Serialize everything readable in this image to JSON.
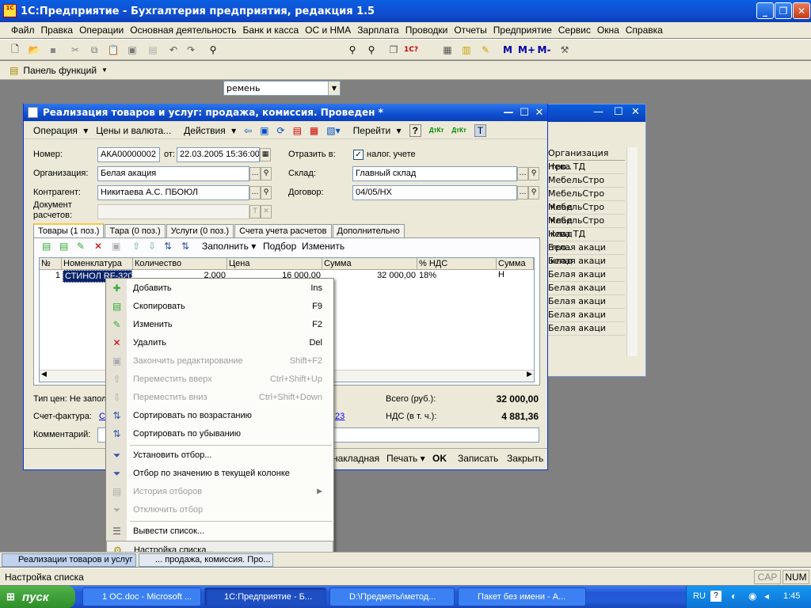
{
  "app": {
    "title": "1С:Предприятие - Бухгалтерия предприятия, редакция 1.5",
    "icon_text": "1C",
    "menu": [
      "Файл",
      "Правка",
      "Операции",
      "Основная деятельность",
      "Банк и касса",
      "ОС и НМА",
      "Зарплата",
      "Проводки",
      "Отчеты",
      "Предприятие",
      "Сервис",
      "Окна",
      "Справка"
    ],
    "search_value": "ремень",
    "panel_label": "Панель функций",
    "m_buttons": [
      "М",
      "М+",
      "М-"
    ]
  },
  "back_window": {
    "col_header": "Организация",
    "rows_left": [
      "тро...",
      "",
      "",
      "клад",
      "клад",
      "клад",
      "тро...",
      "клад",
      "клад",
      "",
      "",
      "",
      "",
      ""
    ],
    "rows": [
      "Нева ТД",
      "МебельСтро",
      "МебельСтро",
      "МебельСтро",
      "МебельСтро",
      "Нева ТД",
      "Белая акаци",
      "Белая акаци",
      "Белая акаци",
      "Белая акаци",
      "Белая акаци",
      "Белая акаци",
      "Белая акаци"
    ]
  },
  "doc": {
    "title": "Реализация товаров и услуг: продажа, комиссия. Проведен *",
    "toolbar": {
      "operation": "Операция",
      "prices": "Цены и валюта...",
      "actions": "Действия",
      "goto": "Перейти"
    },
    "fields": {
      "number_label": "Номер:",
      "number": "АКА00000002",
      "from_label": "от:",
      "date": "22.03.2005 15:36:00",
      "reflect_label": "Отразить в:",
      "tax_label": "налог. учете",
      "org_label": "Организация:",
      "org": "Белая акация",
      "warehouse_label": "Склад:",
      "warehouse": "Главный склад",
      "contractor_label": "Контрагент:",
      "contractor": "Никитаева А.С. ПБОЮЛ",
      "contract_label": "Договор:",
      "contract": "04/05/НХ",
      "settle_label_1": "Документ",
      "settle_label_2": "расчетов:"
    },
    "tabs": [
      "Товары (1 поз.)",
      "Тара (0 поз.)",
      "Услуги (0 поз.)",
      "Счета учета расчетов",
      "Дополнительно"
    ],
    "grid_toolbar": {
      "fill": "Заполнить",
      "pick": "Подбор",
      "change": "Изменить"
    },
    "grid": {
      "headers": [
        "№",
        "Номенклатура",
        "Количество",
        "Цена",
        "Сумма",
        "% НДС",
        "Сумма Н"
      ],
      "row": [
        "1",
        "СТИНОЛ RF-320",
        "2,000",
        "16 000,00",
        "32 000,00",
        "18%",
        ""
      ]
    },
    "footer": {
      "price_type": "Тип цен: Не запол",
      "invoice_label": "Счет-фактура:",
      "invoice_link": "Сч",
      "link_tail": "23",
      "comment_label": "Комментарий:",
      "total_label": "Всего (руб.):",
      "total": "32 000,00",
      "vat_label": "НДС (в т. ч.):",
      "vat": "4 881,36",
      "btn_waybill": "накладная",
      "btn_print": "Печать",
      "btn_ok": "OK",
      "btn_save": "Записать",
      "btn_close": "Закрыть"
    }
  },
  "context_menu": [
    {
      "label": "Добавить",
      "key": "Ins",
      "disabled": false
    },
    {
      "label": "Скопировать",
      "key": "F9",
      "disabled": false
    },
    {
      "label": "Изменить",
      "key": "F2",
      "disabled": false
    },
    {
      "label": "Удалить",
      "key": "Del",
      "disabled": false
    },
    {
      "label": "Закончить редактирование",
      "key": "Shift+F2",
      "disabled": true
    },
    {
      "label": "Переместить вверх",
      "key": "Ctrl+Shift+Up",
      "disabled": true
    },
    {
      "label": "Переместить вниз",
      "key": "Ctrl+Shift+Down",
      "disabled": true
    },
    {
      "label": "Сортировать по возрастанию",
      "key": "",
      "disabled": false
    },
    {
      "label": "Сортировать по убыванию",
      "key": "",
      "disabled": false
    },
    {
      "label": "Установить отбор...",
      "key": "",
      "disabled": false
    },
    {
      "label": "Отбор по значению в текущей колонке",
      "key": "",
      "disabled": false
    },
    {
      "label": "История отборов",
      "key": "",
      "disabled": true
    },
    {
      "label": "Отключить отбор",
      "key": "",
      "disabled": true
    },
    {
      "label": "Вывести список...",
      "key": "",
      "disabled": false
    },
    {
      "label": "Настройка списка...",
      "key": "",
      "disabled": false
    }
  ],
  "window_tabs": [
    "Реализации товаров и услуг",
    "... продажа, комиссия. Про..."
  ],
  "status": {
    "text": "Настройка списка",
    "caps": "CAP",
    "num": "NUM"
  },
  "taskbar": {
    "start": "пуск",
    "tasks": [
      "1 ОС.doc - Microsoft ...",
      "1С:Предприятие - Б...",
      "D:\\Предметы\\метод...",
      "Пакет без имени - А..."
    ],
    "lang": "RU",
    "clock": "1:45"
  },
  "colors": {
    "accent": "#0b3fb8",
    "taskbar": "#225bd7",
    "start": "#2f8f2a",
    "selection": "#0a246a"
  }
}
